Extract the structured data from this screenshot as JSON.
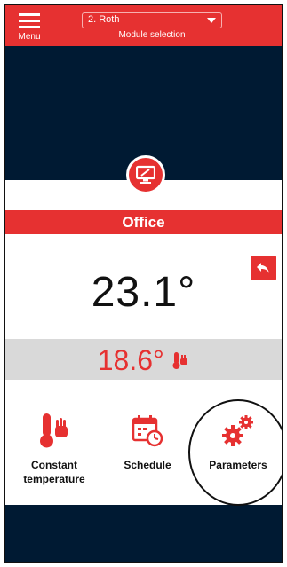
{
  "header": {
    "menu_label": "Menu",
    "module_value": "2. Roth",
    "module_caption": "Module selection"
  },
  "room": {
    "name": "Office",
    "current_temp": "23.1°",
    "setpoint": "18.6°"
  },
  "modes": [
    {
      "label_line1": "Constant",
      "label_line2": "temperature",
      "icon": "thermometer-hand-icon"
    },
    {
      "label_line1": "Schedule",
      "label_line2": "",
      "icon": "calendar-clock-icon"
    },
    {
      "label_line1": "Parameters",
      "label_line2": "",
      "icon": "gears-icon"
    }
  ],
  "colors": {
    "accent": "#e63131",
    "background": "#001a33",
    "band": "#d9d9d9"
  }
}
